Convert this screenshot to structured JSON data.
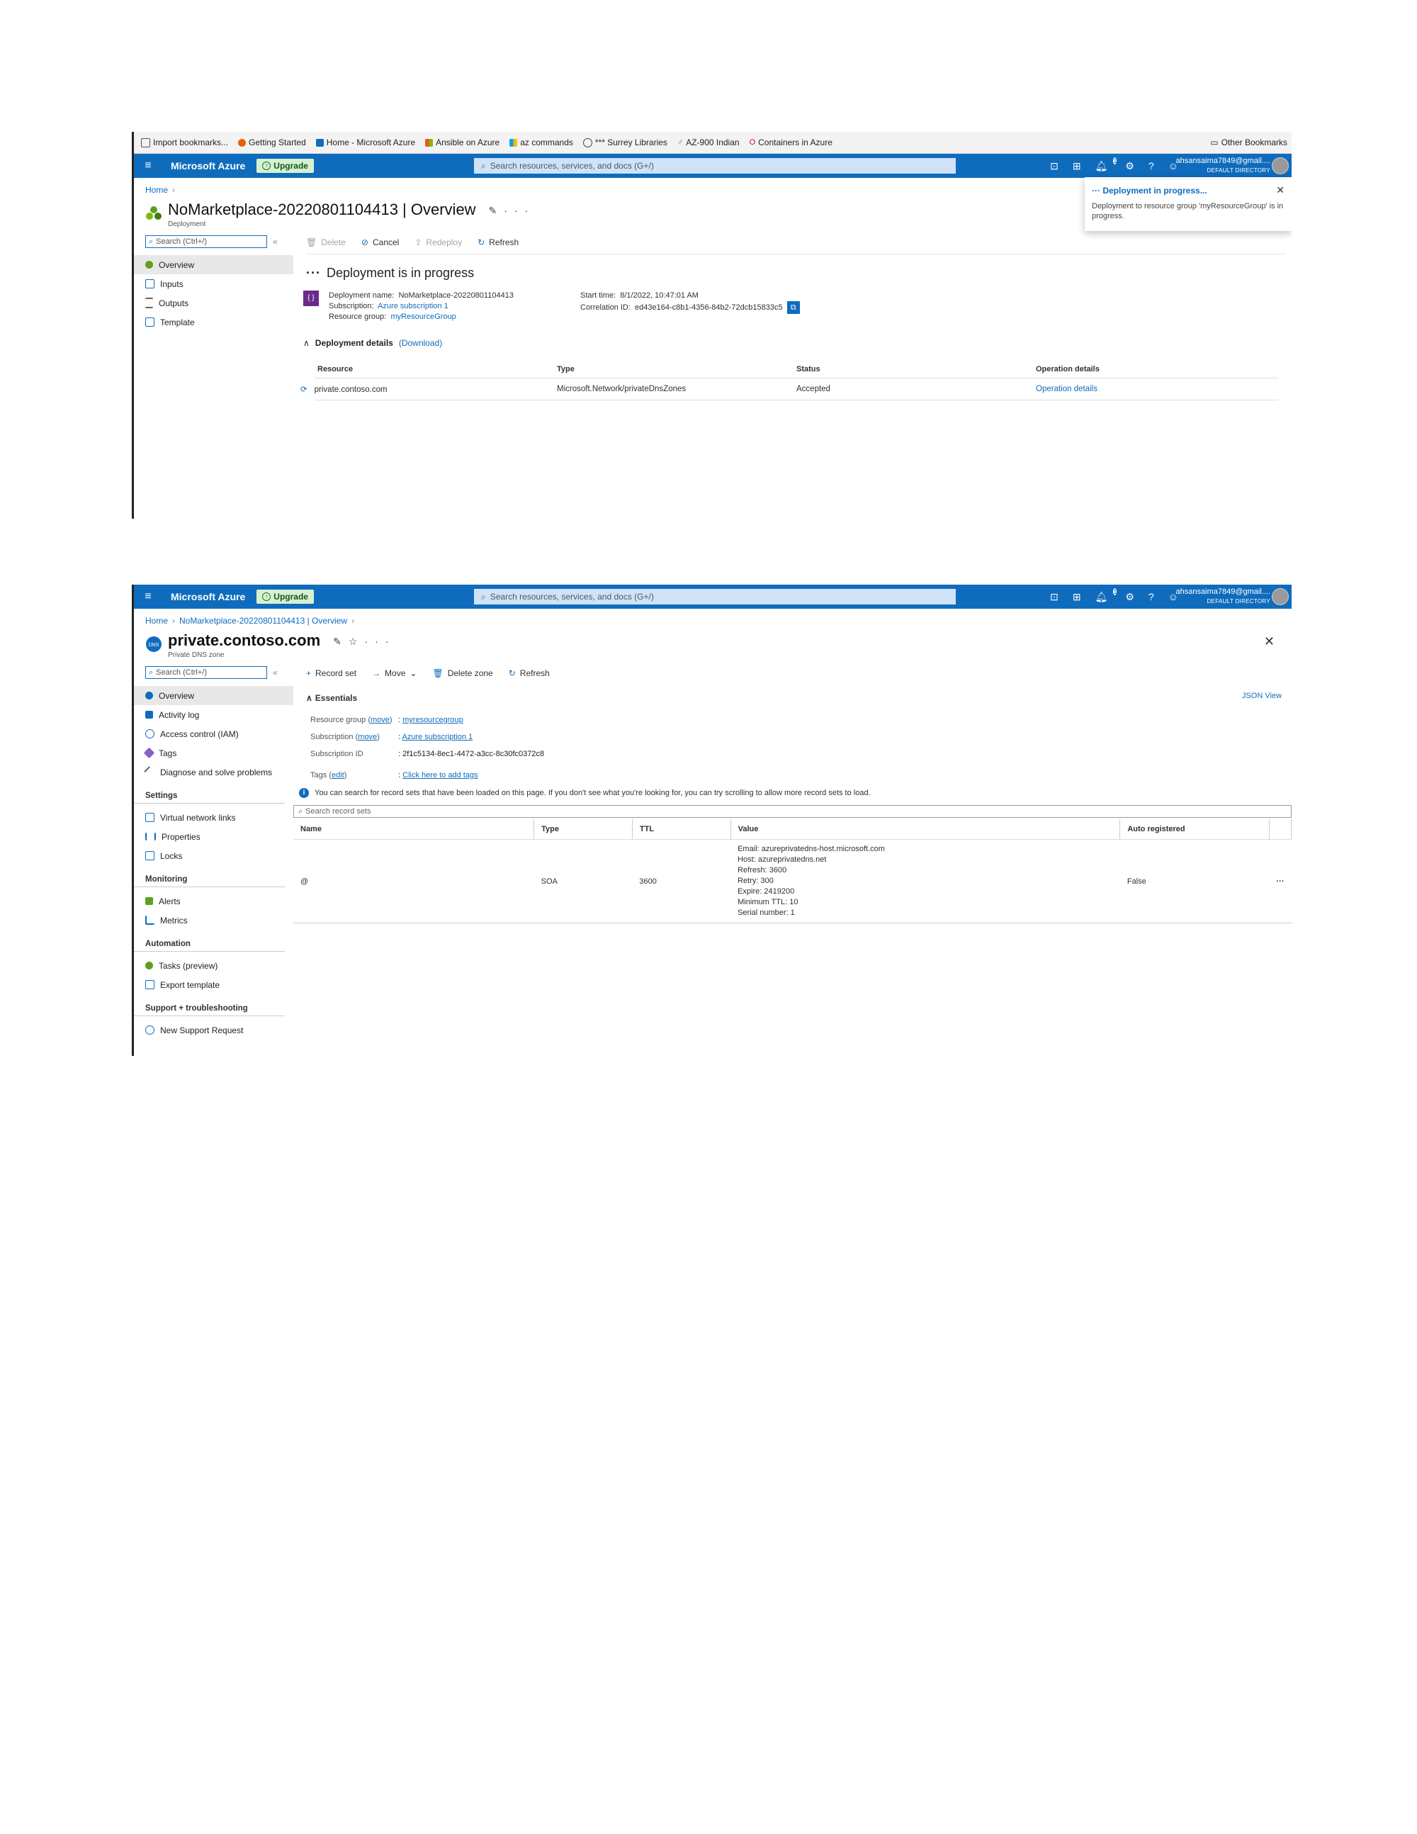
{
  "bookmarks": {
    "items": [
      {
        "label": "Import bookmarks...",
        "color": "#555555"
      },
      {
        "label": "Getting Started",
        "color": "#e66000"
      },
      {
        "label": "Home - Microsoft Azure",
        "color": "#0f6cbd"
      },
      {
        "label": "Ansible on Azure",
        "color": "#f25022"
      },
      {
        "label": "az commands",
        "color": "#7fba00"
      },
      {
        "label": "*** Surrey Libraries",
        "color": "#444444"
      },
      {
        "label": "AZ-900 Indian",
        "color": "#d13438"
      },
      {
        "label": "Containers in Azure",
        "color": "#c50f1f"
      }
    ],
    "other": "Other Bookmarks"
  },
  "topbar": {
    "brand": "Microsoft Azure",
    "upgrade": "Upgrade",
    "search_placeholder": "Search resources, services, and docs (G+/)",
    "notification_count": "1",
    "account_email": "ahsansaima7849@gmail....",
    "account_directory": "DEFAULT DIRECTORY",
    "accent": "#0f6cbd"
  },
  "deployment": {
    "breadcrumb": [
      "Home"
    ],
    "title": "NoMarketplace-20220801104413 | Overview",
    "subtitle": "Deployment",
    "sidebar_search": "Search (Ctrl+/)",
    "nav": [
      {
        "label": "Overview",
        "icon": "deployment-icon"
      },
      {
        "label": "Inputs",
        "icon": "inputs-icon"
      },
      {
        "label": "Outputs",
        "icon": "outputs-icon"
      },
      {
        "label": "Template",
        "icon": "template-icon"
      }
    ],
    "commands": {
      "delete": "Delete",
      "cancel": "Cancel",
      "redeploy": "Redeploy",
      "refresh": "Refresh"
    },
    "status_heading": "Deployment is in progress",
    "info": {
      "name_label": "Deployment name:",
      "name_value": "NoMarketplace-20220801104413",
      "subscription_label": "Subscription:",
      "subscription_value": "Azure subscription 1",
      "rg_label": "Resource group:",
      "rg_value": "myResourceGroup",
      "start_label": "Start time:",
      "start_value": "8/1/2022, 10:47:01 AM",
      "corr_label": "Correlation ID:",
      "corr_value": "ed43e164-c8b1-4356-84b2-72dcb15833c5"
    },
    "details_label": "Deployment details",
    "download_label": "(Download)",
    "table": {
      "headers": [
        "Resource",
        "Type",
        "Status",
        "Operation details"
      ],
      "rows": [
        {
          "resource": "private.contoso.com",
          "type": "Microsoft.Network/privateDnsZones",
          "status": "Accepted",
          "op": "Operation details"
        }
      ]
    },
    "toast": {
      "title": "Deployment in progress...",
      "body": "Deployment to resource group 'myResourceGroup' is in progress."
    }
  },
  "dnszone": {
    "breadcrumb": [
      "Home",
      "NoMarketplace-20220801104413 | Overview"
    ],
    "title": "private.contoso.com",
    "subtitle": "Private DNS zone",
    "sidebar_search": "Search (Ctrl+/)",
    "nav_top": [
      {
        "label": "Overview",
        "icon": "dns-zone-icon"
      },
      {
        "label": "Activity log",
        "icon": "activity-log-icon"
      },
      {
        "label": "Access control (IAM)",
        "icon": "iam-icon"
      },
      {
        "label": "Tags",
        "icon": "tag-icon"
      },
      {
        "label": "Diagnose and solve problems",
        "icon": "wrench-icon"
      }
    ],
    "sections": [
      {
        "title": "Settings",
        "items": [
          {
            "label": "Virtual network links",
            "icon": "link-icon"
          },
          {
            "label": "Properties",
            "icon": "properties-icon"
          },
          {
            "label": "Locks",
            "icon": "lock-icon"
          }
        ]
      },
      {
        "title": "Monitoring",
        "items": [
          {
            "label": "Alerts",
            "icon": "alerts-icon"
          },
          {
            "label": "Metrics",
            "icon": "metrics-icon"
          }
        ]
      },
      {
        "title": "Automation",
        "items": [
          {
            "label": "Tasks (preview)",
            "icon": "tasks-icon"
          },
          {
            "label": "Export template",
            "icon": "export-icon"
          }
        ]
      },
      {
        "title": "Support + troubleshooting",
        "items": [
          {
            "label": "New Support Request",
            "icon": "support-icon"
          }
        ]
      }
    ],
    "commands": {
      "record_set": "Record set",
      "move": "Move",
      "delete_zone": "Delete zone",
      "refresh": "Refresh"
    },
    "essentials_label": "Essentials",
    "json_view": "JSON View",
    "essentials": {
      "rg_key": "Resource group",
      "rg_move": "move",
      "rg_value": "myresourcegroup",
      "sub_key": "Subscription",
      "sub_move": "move",
      "sub_value": "Azure subscription 1",
      "subid_key": "Subscription ID",
      "subid_value": "2f1c5134-8ec1-4472-a3cc-8c30fc0372c8",
      "tags_key": "Tags",
      "tags_edit": "edit",
      "tags_value": "Click here to add tags"
    },
    "info_text": "You can search for record sets that have been loaded on this page. If you don't see what you're looking for, you can try scrolling to allow more record sets to load.",
    "record_search": "Search record sets",
    "table": {
      "headers": [
        "Name",
        "Type",
        "TTL",
        "Value",
        "Auto registered"
      ],
      "row": {
        "name": "@",
        "type": "SOA",
        "ttl": "3600",
        "value_lines": [
          "Email: azureprivatedns-host.microsoft.com",
          "Host: azureprivatedns.net",
          "Refresh: 3600",
          "Retry: 300",
          "Expire: 2419200",
          "Minimum TTL: 10",
          "Serial number: 1"
        ],
        "auto": "False"
      }
    }
  }
}
